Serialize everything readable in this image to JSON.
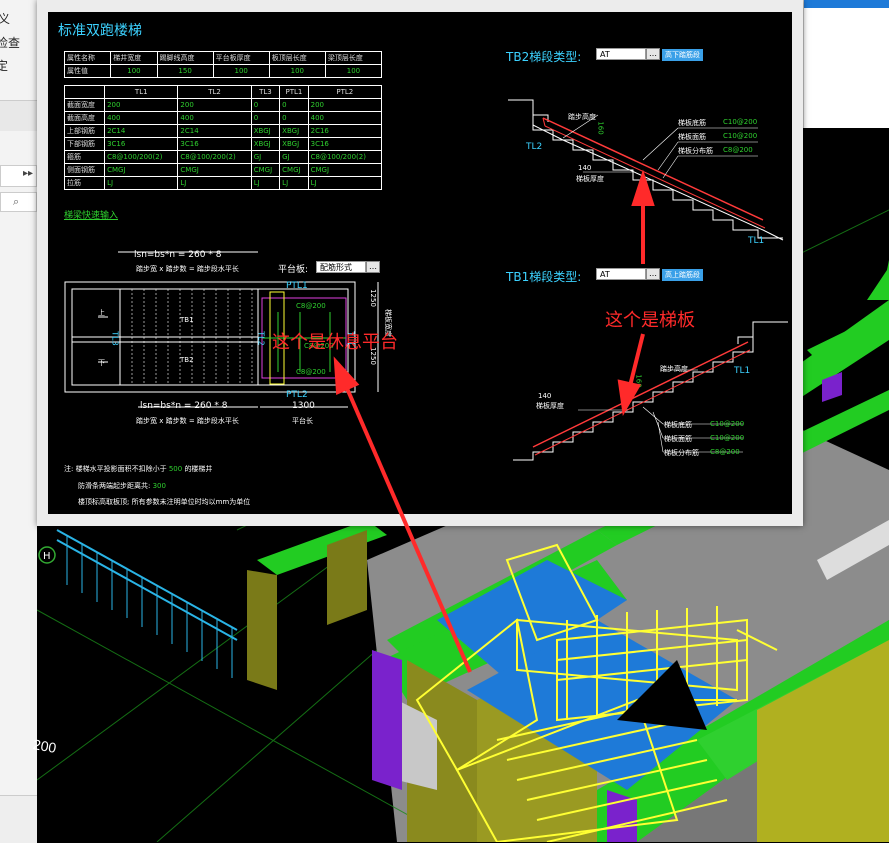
{
  "host": {
    "sidebar_labels": [
      "义",
      "检查",
      "定"
    ],
    "dim_label": "200"
  },
  "dialog": {
    "title": "标准双跑楼梯",
    "prop_table": {
      "headers": [
        "属性名称",
        "梯井宽度",
        "踢脚线高度",
        "平台板厚度",
        "板顶层长度",
        "梁顶层长度"
      ],
      "values": [
        "属性值",
        "100",
        "150",
        "100",
        "100",
        "100"
      ]
    },
    "beam_table": {
      "columns": [
        "",
        "TL1",
        "TL2",
        "TL3",
        "PTL1",
        "PTL2"
      ],
      "rows": [
        [
          "截面宽度",
          "200",
          "200",
          "0",
          "0",
          "200"
        ],
        [
          "截面高度",
          "400",
          "400",
          "0",
          "0",
          "400"
        ],
        [
          "上部钢筋",
          "2C14",
          "2C14",
          "XBGJ",
          "XBGJ",
          "2C16"
        ],
        [
          "下部钢筋",
          "3C16",
          "3C16",
          "XBGJ",
          "XBGJ",
          "3C16"
        ],
        [
          "箍筋",
          "C8@100/200(2)",
          "C8@100/200(2)",
          "GJ",
          "GJ",
          "C8@100/200(2)"
        ],
        [
          "侧面钢筋",
          "CMGJ",
          "CMGJ",
          "CMGJ",
          "CMGJ",
          "CMGJ"
        ],
        [
          "拉筋",
          "LJ",
          "LJ",
          "LJ",
          "LJ",
          "LJ"
        ]
      ]
    },
    "quick_input_link": "梯梁快速输入",
    "plan": {
      "formula_top": "lsn=bs*n = 260 * 8",
      "formula_top_sub": "踏步宽 x 踏步数 = 踏步段水平长",
      "formula_bottom": "lsn=bs*n = 260 * 8",
      "formula_bottom_sub": "踏步宽 x 踏步数 = 踏步段水平长",
      "platform_label": "平台板:",
      "platform_value": "配筋形式",
      "platform_len_value": "1300",
      "platform_len_label": "平台长",
      "up": "上",
      "down": "下",
      "tb1": "TB1",
      "tb2": "TB2",
      "ptl1": "PTL1",
      "ptl2": "PTL2",
      "tl1": "TL1",
      "tl2": "TL2",
      "tl3": "TL3",
      "rebar_a": "C8@200",
      "rebar_b": "C8@200",
      "rebar_c": "C8@200",
      "dim_1250_a": "1250",
      "dim_1250_b": "1250",
      "side_label": "梯板宽度"
    },
    "notes": {
      "line1_prefix": "注: 楼梯水平投影面积不扣除小于",
      "line1_value": "500",
      "line1_suffix": "的楼梯井",
      "line2_prefix": "防滑条两端起步距离共:",
      "line2_value": "300",
      "line3": "楼顶标高取板顶; 所有参数未注明单位时均以mm为单位"
    },
    "tb2": {
      "label": "TB2梯段类型:",
      "value": "AT",
      "chip": "高下踏筋段",
      "annot": [
        "踏步高度",
        "梯板厚度",
        "梯板底筋",
        "梯板面筋",
        "梯板分布筋",
        "TL2",
        "TL1"
      ],
      "values": [
        "160",
        "140",
        "C10@200",
        "C10@200",
        "C8@200"
      ]
    },
    "tb1": {
      "label": "TB1梯段类型:",
      "value": "AT",
      "chip": "高上踏筋段",
      "annot": [
        "踏步高度",
        "梯板厚度",
        "梯板底筋",
        "梯板面筋",
        "梯板分布筋",
        "TL1"
      ],
      "values": [
        "160",
        "140",
        "C10@200",
        "C10@200",
        "C8@200"
      ]
    },
    "callouts": {
      "rest_platform": "这个是休息平台",
      "stair_slab": "这个是梯板"
    }
  },
  "colors": {
    "accent_cyan": "#3cd2ff",
    "callout_red": "#ff2a2a",
    "model_green": "#22cc22",
    "model_blue": "#1e7ad8",
    "model_yellow": "#ffff33",
    "model_olive": "#8a8a1e"
  }
}
